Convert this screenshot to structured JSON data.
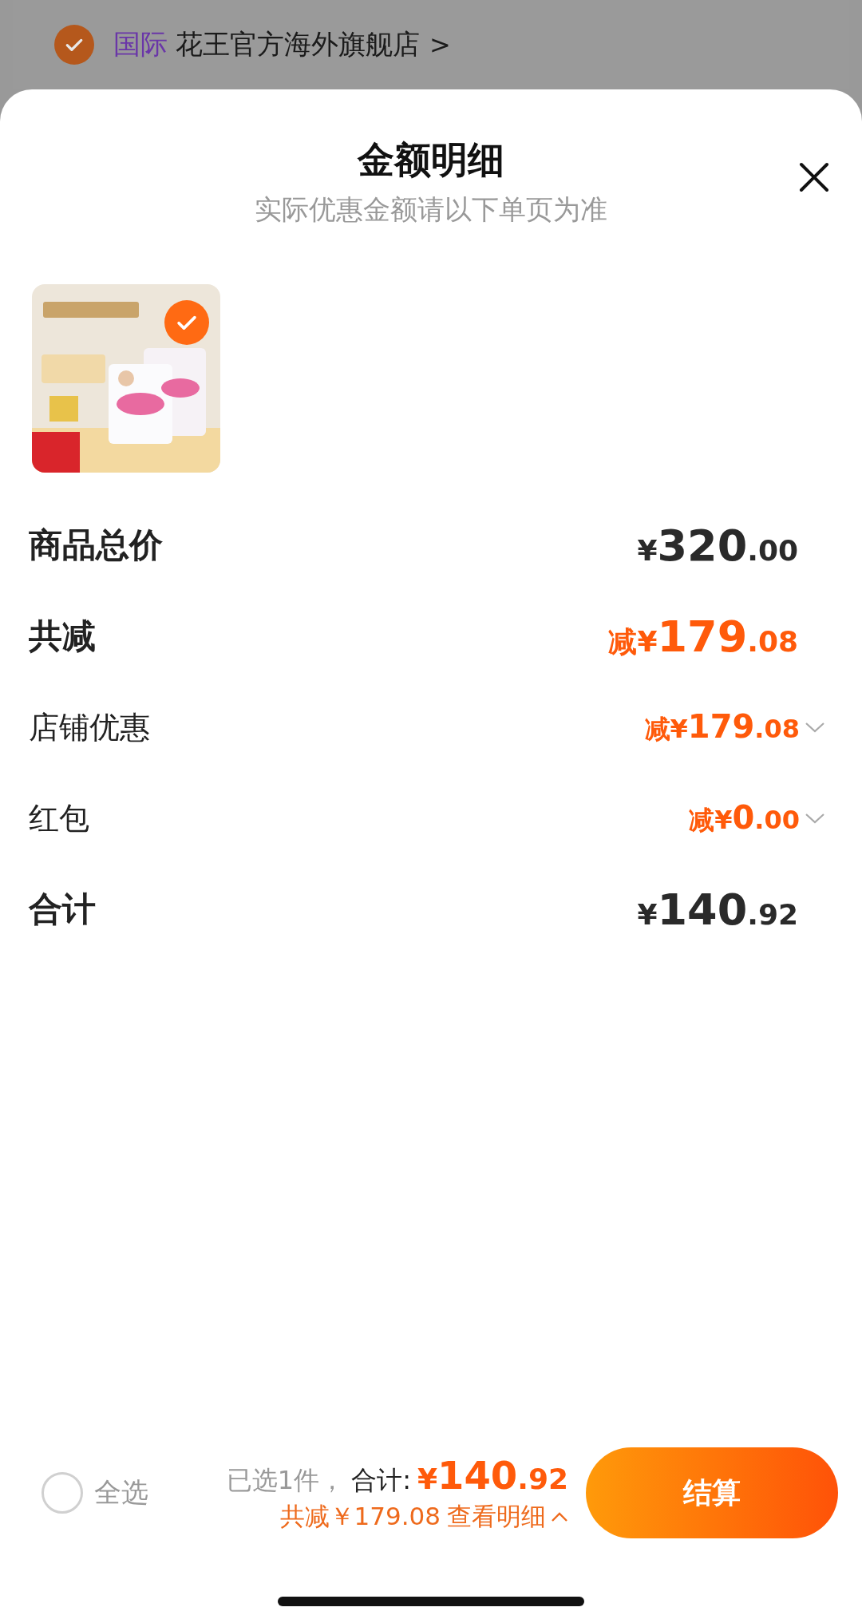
{
  "store": {
    "checked": true,
    "tag": "国际",
    "name": "花王官方海外旗舰店",
    "arrow": ">"
  },
  "sheet": {
    "title": "金额明细",
    "subtitle": "实际优惠金额请以下单页为准"
  },
  "product": {
    "kind": "picture",
    "checked": true
  },
  "rows": [
    {
      "kind": "major",
      "label": "商品总价",
      "amount": "¥320.00",
      "discount": false
    },
    {
      "kind": "major",
      "label": "共减",
      "amount": "减¥179.08",
      "discount": true
    },
    {
      "kind": "minor",
      "label": "店铺优惠",
      "amount": "减¥179.08",
      "discount": true,
      "expanded": false
    },
    {
      "kind": "minor",
      "label": "红包",
      "amount": "减¥0.00",
      "discount": true,
      "expanded": false
    },
    {
      "kind": "major",
      "label": "合计",
      "amount": "¥140.92",
      "discount": false
    }
  ],
  "footer": {
    "select_all": {
      "label": "全选",
      "checked": false
    },
    "selected": "已选1件，",
    "total_label": "合计:",
    "total": "¥140.92",
    "saved": "共减￥179.08",
    "details": "查看明细",
    "details_expanded": true,
    "checkout": "结算"
  }
}
